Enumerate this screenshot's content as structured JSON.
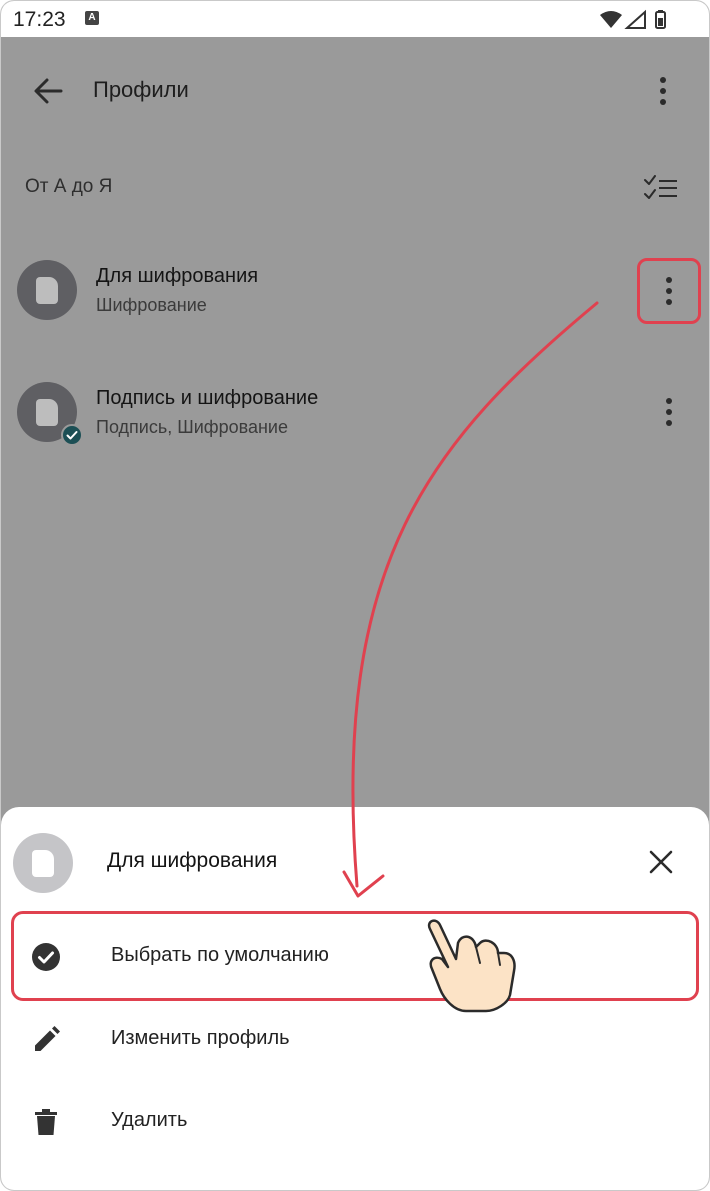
{
  "status_bar": {
    "time": "17:23",
    "keyboard_badge": "A"
  },
  "app_bar": {
    "title": "Профили"
  },
  "sort": {
    "label": "От А до Я"
  },
  "profiles": [
    {
      "title": "Для шифрования",
      "subtitle": "Шифрование",
      "is_default": false
    },
    {
      "title": "Подпись и шифрование",
      "subtitle": "Подпись, Шифрование",
      "is_default": true
    }
  ],
  "sheet": {
    "title": "Для шифрования",
    "options": [
      {
        "label": "Выбрать по умолчанию",
        "icon": "check-circle-icon"
      },
      {
        "label": "Изменить профиль",
        "icon": "pencil-icon"
      },
      {
        "label": "Удалить",
        "icon": "trash-icon"
      }
    ]
  },
  "colors": {
    "highlight": "#e0414f",
    "scrim": "#9a9a9a",
    "default_badge": "#1c4f55"
  }
}
